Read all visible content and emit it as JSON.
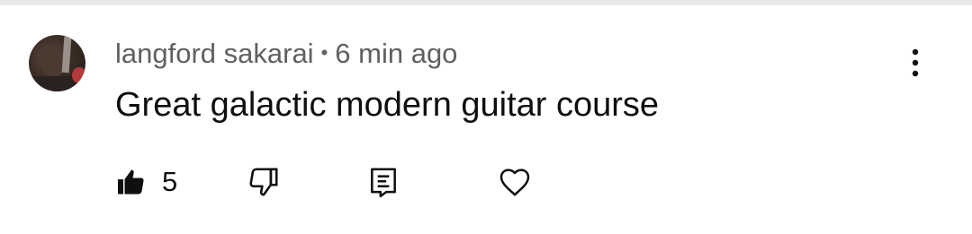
{
  "comment": {
    "author": "langford sakarai",
    "separator": "•",
    "timestamp": "6 min ago",
    "text": "Great galactic modern guitar course"
  },
  "actions": {
    "like_count": "5",
    "like_icon": "thumbs-up-filled-icon",
    "dislike_icon": "thumbs-down-icon",
    "reply_icon": "reply-comment-icon",
    "heart_icon": "heart-icon",
    "more_icon": "more-vertical-icon"
  },
  "colors": {
    "text_primary": "#0f0f0f",
    "text_secondary": "#606060",
    "divider": "#e9e9e9"
  }
}
